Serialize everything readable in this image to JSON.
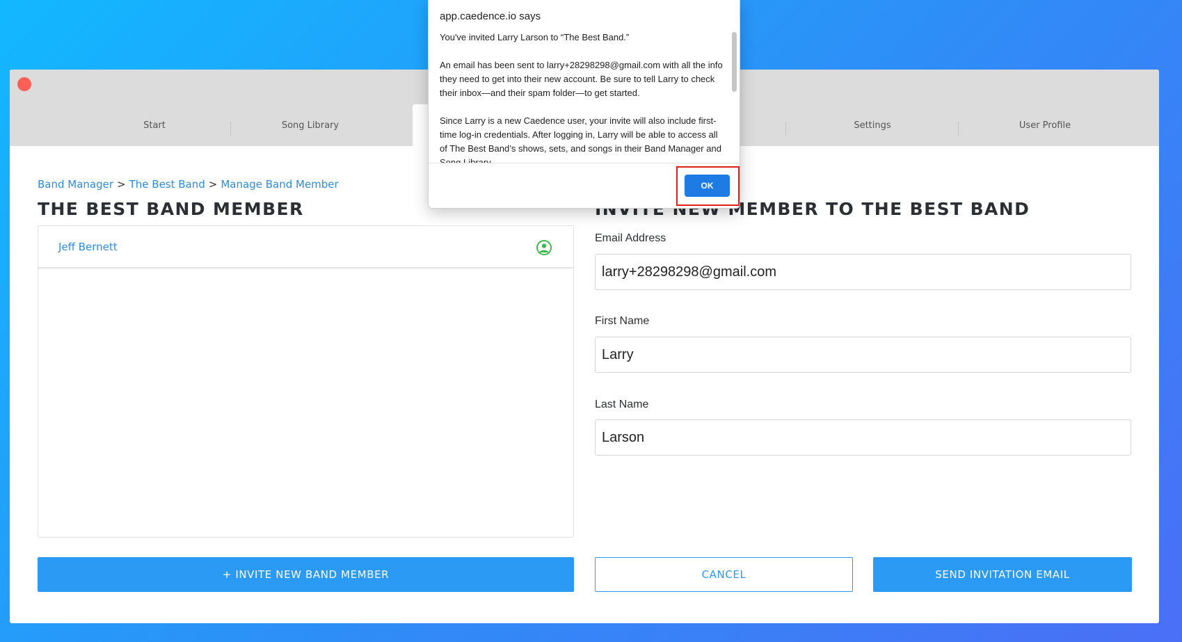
{
  "window": {
    "tabs": [
      {
        "label": "Start"
      },
      {
        "label": "Song Library"
      },
      {
        "label": ""
      },
      {
        "label": ""
      },
      {
        "label": "Settings"
      },
      {
        "label": "User Profile"
      }
    ],
    "active_tab_index": 2
  },
  "breadcrumb": {
    "items": [
      "Band Manager",
      "The Best Band",
      "Manage Band Member"
    ],
    "separator": ">"
  },
  "left": {
    "heading": "THE BEST BAND MEMBER",
    "members": [
      {
        "name": "Jeff Bernett",
        "icon": "user-circle-icon",
        "icon_color": "#3dba4e"
      }
    ],
    "invite_button": "+ INVITE NEW BAND MEMBER"
  },
  "right": {
    "heading": "INVITE NEW MEMBER TO THE BEST BAND",
    "fields": {
      "email": {
        "label": "Email Address",
        "value": "larry+28298298@gmail.com"
      },
      "first_name": {
        "label": "First Name",
        "value": "Larry"
      },
      "last_name": {
        "label": "Last Name",
        "value": "Larson"
      }
    },
    "cancel_button": "CANCEL",
    "send_button": "SEND INVITATION EMAIL"
  },
  "dialog": {
    "title": "app.caedence.io says",
    "paragraphs": [
      "You've invited Larry Larson to “The Best Band.”",
      " An email has been sent to larry+28298298@gmail.com with all the info they need to get into their new account. Be sure to tell Larry to check their inbox—and their spam folder—to get started.",
      "Since Larry is a new Caedence user, your invite will also include first-time log-in credentials. After logging in, Larry will be able to access all of The Best Band’s shows, sets, and songs in their Band Manager and Song Library."
    ],
    "ok_button": "OK"
  },
  "colors": {
    "accent": "#2a9af5",
    "link": "#2b8cde",
    "highlight": "#e0211b",
    "close_button": "#fe5f57"
  }
}
